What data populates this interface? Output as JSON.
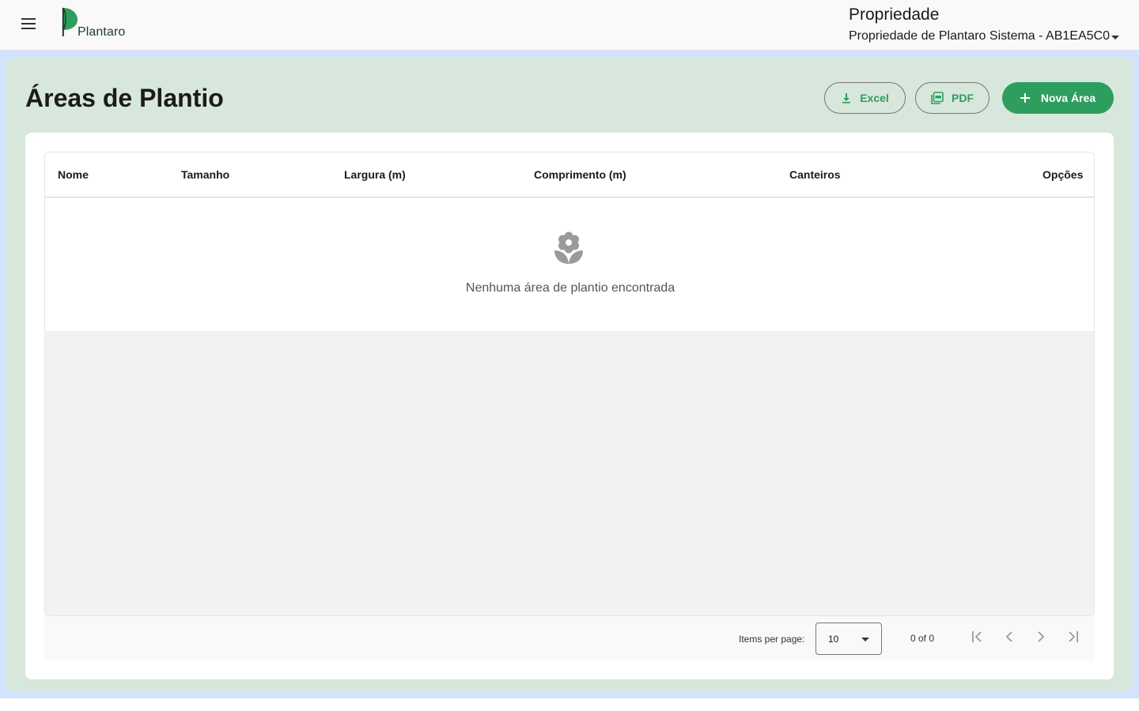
{
  "header": {
    "logo_text": "Plantaro",
    "property_title": "Propriedade",
    "property_selected": "Propriedade de Plantaro Sistema - AB1EA5C0"
  },
  "page": {
    "title": "Áreas de Plantio",
    "actions": {
      "excel_label": "Excel",
      "pdf_label": "PDF",
      "new_label": "Nova Área"
    }
  },
  "table": {
    "columns": [
      "Nome",
      "Tamanho",
      "Largura (m)",
      "Comprimento (m)",
      "Canteiros",
      "Opções"
    ],
    "empty_message": "Nenhuma área de plantio encontrada"
  },
  "paginator": {
    "items_per_page_label": "Items per page:",
    "page_size": "10",
    "range_label": "0 of 0"
  },
  "colors": {
    "brand": "#2e9e5f",
    "content_bg": "#d8e7dc",
    "frame_bg": "#d3e3fd"
  },
  "icons": {
    "menu": "menu-icon",
    "excel": "download-icon",
    "pdf": "pdf-icon",
    "new": "plus-icon",
    "empty": "flower-icon",
    "first": "first-page-icon",
    "prev": "chevron-left-icon",
    "next": "chevron-right-icon",
    "last": "last-page-icon"
  }
}
